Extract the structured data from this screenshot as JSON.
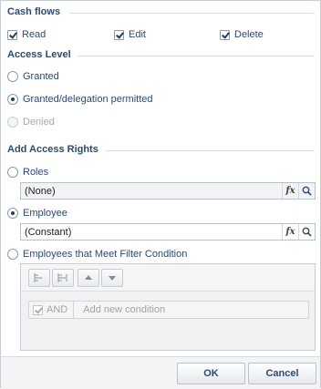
{
  "cash_flows": {
    "title": "Cash flows",
    "read_label": "Read",
    "edit_label": "Edit",
    "delete_label": "Delete"
  },
  "access_level": {
    "title": "Access Level",
    "granted_label": "Granted",
    "granted_delegation_label": "Granted/delegation permitted",
    "denied_label": "Denied"
  },
  "add_access_rights": {
    "title": "Add Access Rights",
    "roles_label": "Roles",
    "roles_value": "(None)",
    "employee_label": "Employee",
    "employee_value": "(Constant)",
    "filter_label": "Employees that Meet Filter Condition",
    "condition_and_label": "AND",
    "condition_add_label": "Add new condition"
  },
  "icons": {
    "function": "fx",
    "search": "search-icon",
    "up": "up-arrow-icon",
    "down": "down-arrow-icon"
  },
  "footer": {
    "ok_label": "OK",
    "cancel_label": "Cancel"
  }
}
